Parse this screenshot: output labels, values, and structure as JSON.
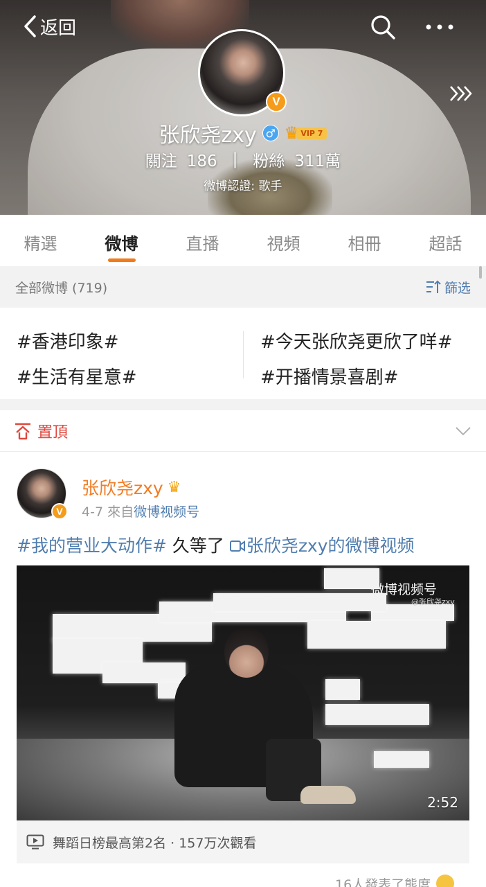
{
  "header": {
    "back_label": "返回",
    "profile_name": "张欣尧zxy",
    "gender_symbol": "♂",
    "vip_label": "VIP 7",
    "following_label": "關注",
    "following_count": "186",
    "stats_separator": "|",
    "followers_label": "粉絲",
    "followers_count": "311萬",
    "verification": "微博認證: 歌手",
    "verified_badge": "V"
  },
  "tabs": [
    {
      "label": "精選"
    },
    {
      "label": "微博",
      "active": true
    },
    {
      "label": "直播"
    },
    {
      "label": "視頻"
    },
    {
      "label": "相冊"
    },
    {
      "label": "超話"
    }
  ],
  "filter_bar": {
    "count_label": "全部微博 (719)",
    "filter_label": "篩选"
  },
  "topics": [
    "#香港印象#",
    "#今天张欣尧更欣了咩#",
    "#生活有星意#",
    "#开播情景喜剧#"
  ],
  "pinned": {
    "label": "置頂"
  },
  "post": {
    "author": "张欣尧zxy",
    "verified_badge": "V",
    "date": "4-7",
    "from_label": "來自",
    "source": "微博视频号",
    "hashtag": "#我的营业大动作#",
    "text": " 久等了 ",
    "video_link": "张欣尧zxy的微博视频",
    "video": {
      "watermark": "微博视频号",
      "watermark_sub": "@张欣尧zxy",
      "duration": "2:52"
    },
    "rank_text": "舞蹈日榜最高第2名 · 157万次觀看",
    "reaction_text": "16人發表了態度"
  },
  "colors": {
    "accent_orange": "#f07b1d",
    "link_blue": "#507daf",
    "pin_red": "#e0473d",
    "verified_orange": "#f59c1a"
  }
}
